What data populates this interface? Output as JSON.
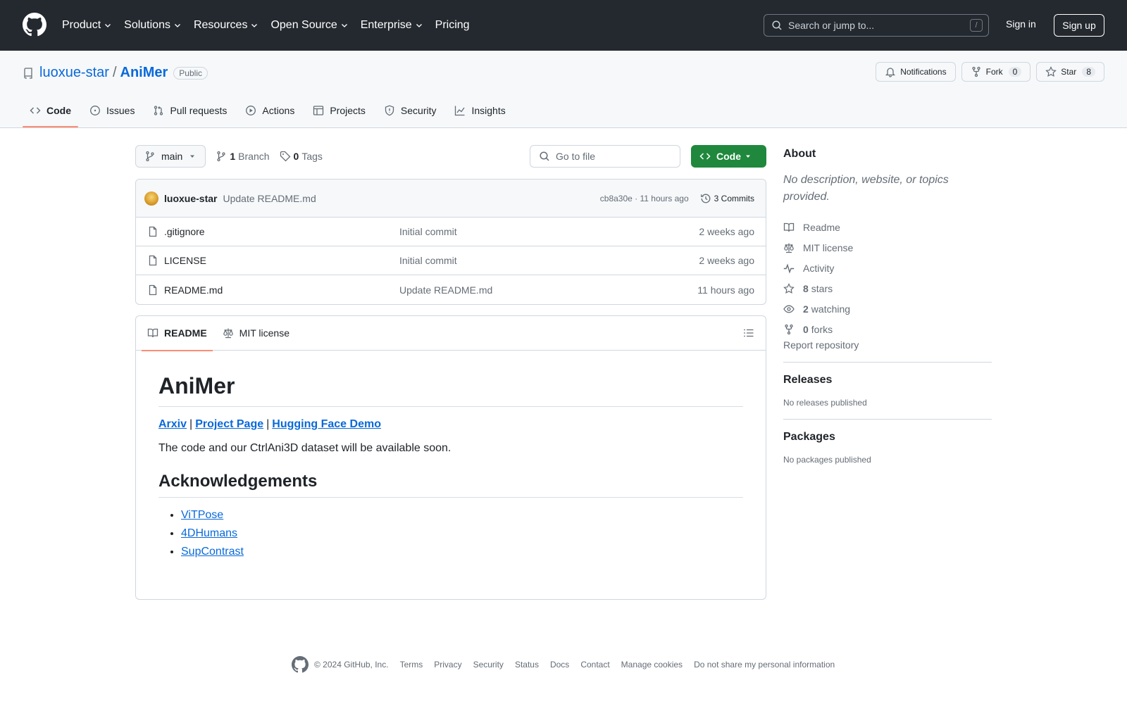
{
  "header": {
    "nav": [
      "Product",
      "Solutions",
      "Resources",
      "Open Source",
      "Enterprise",
      "Pricing"
    ],
    "search_placeholder": "Search or jump to...",
    "search_key": "/",
    "sign_in": "Sign in",
    "sign_up": "Sign up"
  },
  "repo": {
    "owner": "luoxue-star",
    "separator": "/",
    "name": "AniMer",
    "visibility": "Public",
    "notifications": "Notifications",
    "fork_label": "Fork",
    "fork_count": "0",
    "star_label": "Star",
    "star_count": "8"
  },
  "tabs": [
    "Code",
    "Issues",
    "Pull requests",
    "Actions",
    "Projects",
    "Security",
    "Insights"
  ],
  "toolbar": {
    "branch": "main",
    "branch_count": "1",
    "branch_label": "Branch",
    "tag_count": "0",
    "tag_label": "Tags",
    "goto_placeholder": "Go to file",
    "code_button": "Code"
  },
  "latest_commit": {
    "author": "luoxue-star",
    "message": "Update README.md",
    "hash_time": "cb8a30e · 11 hours ago",
    "commits": "3 Commits"
  },
  "files": [
    {
      "name": ".gitignore",
      "message": "Initial commit",
      "age": "2 weeks ago"
    },
    {
      "name": "LICENSE",
      "message": "Initial commit",
      "age": "2 weeks ago"
    },
    {
      "name": "README.md",
      "message": "Update README.md",
      "age": "11 hours ago"
    }
  ],
  "readme": {
    "tab_readme": "README",
    "tab_license": "MIT license",
    "title": "AniMer",
    "links": [
      "Arxiv",
      "Project Page",
      "Hugging Face Demo"
    ],
    "link_sep": "|",
    "paragraph": "The code and our CtrlAni3D dataset will be available soon.",
    "ack_heading": "Acknowledgements",
    "ack_items": [
      "ViTPose",
      "4DHumans",
      "SupContrast"
    ]
  },
  "sidebar": {
    "about_title": "About",
    "about_desc": "No description, website, or topics provided.",
    "readme": "Readme",
    "license": "MIT license",
    "activity": "Activity",
    "stars_count": "8",
    "stars_label": "stars",
    "watching_count": "2",
    "watching_label": "watching",
    "forks_count": "0",
    "forks_label": "forks",
    "report": "Report repository",
    "releases_title": "Releases",
    "releases_sub": "No releases published",
    "packages_title": "Packages",
    "packages_sub": "No packages published"
  },
  "footer": {
    "copyright": "© 2024 GitHub, Inc.",
    "links": [
      "Terms",
      "Privacy",
      "Security",
      "Status",
      "Docs",
      "Contact",
      "Manage cookies",
      "Do not share my personal information"
    ]
  },
  "colors": {
    "header_bg": "#24292f",
    "accent_link": "#0969da",
    "code_button": "#1f883d",
    "tab_underline": "#fd8c73"
  }
}
